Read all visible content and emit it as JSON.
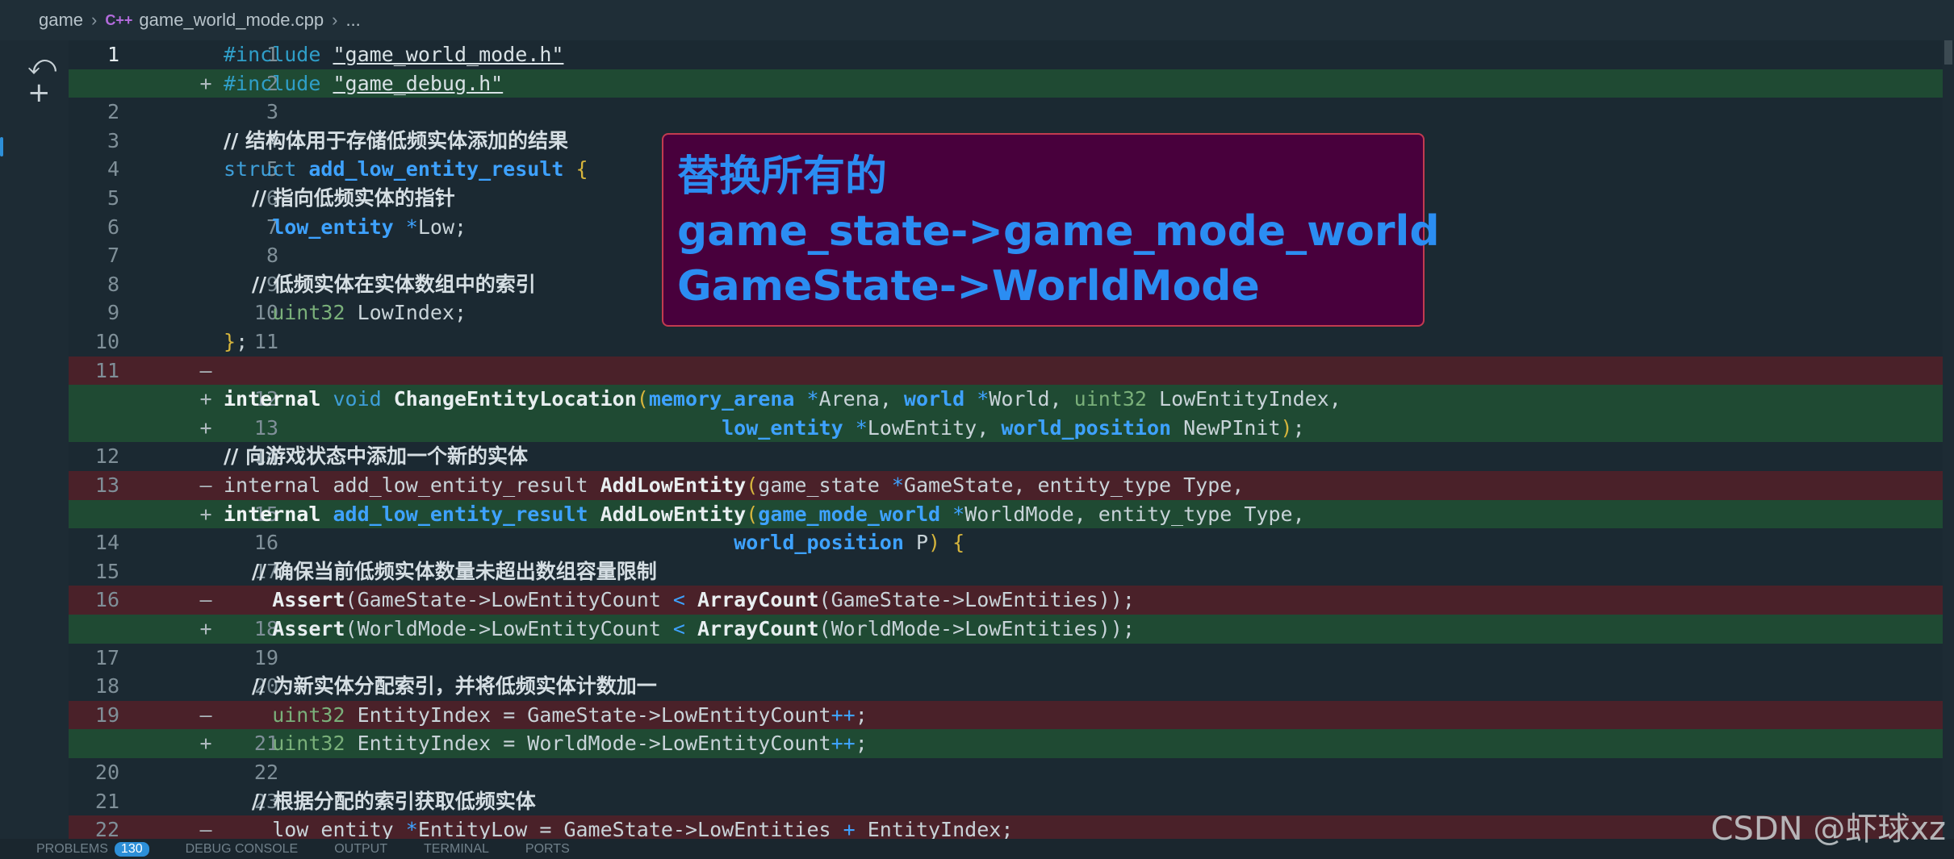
{
  "breadcrumb": {
    "root": "game",
    "file": "game_world_mode.cpp",
    "tail": "..."
  },
  "overlay": {
    "line1": "替换所有的",
    "line2": "game_state->game_mode_world",
    "line3": "GameState->WorldMode"
  },
  "bottom": {
    "problems": "PROBLEMS",
    "problems_count": "130",
    "debug_console": "DEBUG CONSOLE",
    "output": "OUTPUT",
    "terminal": "TERMINAL",
    "ports": "PORTS"
  },
  "watermark": "CSDN @虾球xz",
  "icons": {
    "undo": "undo-arrow-icon",
    "add": "plus-icon"
  },
  "colors": {
    "added": "#1f4a33",
    "removed": "#4a2129",
    "overlay_bg": "#48003c",
    "overlay_text": "#2b8df2"
  },
  "lines": [
    {
      "old": "1",
      "new": "1",
      "m": "",
      "t": "",
      "cls": "cur",
      "parts": [
        [
          "#include ",
          "k-macro"
        ],
        [
          "\"game_world_mode.h\"",
          "k-str"
        ]
      ]
    },
    {
      "old": "",
      "new": "2",
      "m": "+",
      "t": "add",
      "cls": "",
      "parts": [
        [
          "#include ",
          "k-macro"
        ],
        [
          "\"game_debug.h\"",
          "k-str"
        ]
      ]
    },
    {
      "old": "2",
      "new": "3",
      "m": "",
      "t": "",
      "cls": "",
      "parts": []
    },
    {
      "old": "3",
      "new": "4",
      "m": "",
      "t": "",
      "cls": "",
      "parts": [
        [
          "// 结构体用于存储低频实体添加的结果",
          "k-comment"
        ]
      ]
    },
    {
      "old": "4",
      "new": "5",
      "m": "",
      "t": "",
      "cls": "",
      "parts": [
        [
          "struct ",
          "k-kw"
        ],
        [
          "add_low_entity_result ",
          "k-type"
        ],
        [
          "{",
          "k-brace"
        ]
      ]
    },
    {
      "old": "5",
      "new": "6",
      "m": "",
      "t": "",
      "cls": "",
      "parts": [
        [
          "    // 指向低频实体的指针",
          "k-comment"
        ]
      ]
    },
    {
      "old": "6",
      "new": "7",
      "m": "",
      "t": "",
      "cls": "",
      "parts": [
        [
          "    low_entity ",
          "k-type"
        ],
        [
          "*",
          "k-ptr"
        ],
        [
          "Low;",
          ""
        ]
      ]
    },
    {
      "old": "7",
      "new": "8",
      "m": "",
      "t": "",
      "cls": "",
      "parts": []
    },
    {
      "old": "8",
      "new": "9",
      "m": "",
      "t": "",
      "cls": "",
      "parts": [
        [
          "    // 低频实体在实体数组中的索引",
          "k-comment"
        ]
      ]
    },
    {
      "old": "9",
      "new": "10",
      "m": "",
      "t": "",
      "cls": "",
      "parts": [
        [
          "    uint32 ",
          "k-dim"
        ],
        [
          "LowIndex;",
          ""
        ]
      ]
    },
    {
      "old": "10",
      "new": "11",
      "m": "",
      "t": "",
      "cls": "",
      "parts": [
        [
          "}",
          "k-brace"
        ],
        [
          ";",
          ""
        ]
      ]
    },
    {
      "old": "11",
      "new": "",
      "m": "—",
      "t": "del",
      "cls": "",
      "parts": []
    },
    {
      "old": "",
      "new": "12",
      "m": "+",
      "t": "add",
      "cls": "",
      "parts": [
        [
          "internal ",
          "k-bold"
        ],
        [
          "void ",
          "k-kw"
        ],
        [
          "ChangeEntityLocation",
          "k-func"
        ],
        [
          "(",
          "k-brace"
        ],
        [
          "memory_arena ",
          "k-type"
        ],
        [
          "*",
          "k-ptr"
        ],
        [
          "Arena, ",
          ""
        ],
        [
          "world ",
          "k-type"
        ],
        [
          "*",
          "k-ptr"
        ],
        [
          "World, ",
          ""
        ],
        [
          "uint32 ",
          "k-dim"
        ],
        [
          "LowEntityIndex,",
          ""
        ]
      ]
    },
    {
      "old": "",
      "new": "13",
      "m": "+",
      "t": "add",
      "cls": "",
      "parts": [
        [
          "                                         ",
          ""
        ],
        [
          "low_entity ",
          "k-type"
        ],
        [
          "*",
          "k-ptr"
        ],
        [
          "LowEntity, ",
          ""
        ],
        [
          "world_position ",
          "k-type"
        ],
        [
          "NewPInit",
          ""
        ],
        [
          ")",
          "k-brace"
        ],
        [
          ";",
          ""
        ]
      ]
    },
    {
      "old": "12",
      "new": "14",
      "m": "",
      "t": "",
      "cls": "",
      "parts": [
        [
          "// 向游戏状态中添加一个新的实体",
          "k-comment"
        ]
      ]
    },
    {
      "old": "13",
      "new": "",
      "m": "—",
      "t": "del",
      "cls": "",
      "parts": [
        [
          "internal add_low_entity_result ",
          ""
        ],
        [
          "AddLowEntity",
          "k-func"
        ],
        [
          "(",
          "k-brace"
        ],
        [
          "game_state ",
          ""
        ],
        [
          "*",
          "k-ptr"
        ],
        [
          "GameState, entity_type Type,",
          ""
        ]
      ]
    },
    {
      "old": "",
      "new": "15",
      "m": "+",
      "t": "add",
      "cls": "",
      "parts": [
        [
          "internal ",
          "k-bold"
        ],
        [
          "add_low_entity_result ",
          "k-type"
        ],
        [
          "AddLowEntity",
          "k-func"
        ],
        [
          "(",
          "k-brace"
        ],
        [
          "game_mode_world ",
          "k-type"
        ],
        [
          "*",
          "k-ptr"
        ],
        [
          "WorldMode, entity_type Type,",
          ""
        ]
      ]
    },
    {
      "old": "14",
      "new": "16",
      "m": "",
      "t": "",
      "cls": "",
      "parts": [
        [
          "                                          ",
          ""
        ],
        [
          "world_position ",
          "k-type"
        ],
        [
          "P",
          ""
        ],
        [
          ") {",
          "k-brace"
        ]
      ]
    },
    {
      "old": "15",
      "new": "17",
      "m": "",
      "t": "",
      "cls": "",
      "parts": [
        [
          "    // 确保当前低频实体数量未超出数组容量限制",
          "k-comment"
        ]
      ]
    },
    {
      "old": "16",
      "new": "",
      "m": "—",
      "t": "del",
      "cls": "",
      "parts": [
        [
          "    ",
          ""
        ],
        [
          "Assert",
          "k-func"
        ],
        [
          "(GameState->LowEntityCount ",
          ""
        ],
        [
          "< ",
          "k-lt"
        ],
        [
          "ArrayCount",
          "k-func"
        ],
        [
          "(GameState->LowEntities));",
          ""
        ]
      ]
    },
    {
      "old": "",
      "new": "18",
      "m": "+",
      "t": "add",
      "cls": "",
      "parts": [
        [
          "    ",
          ""
        ],
        [
          "Assert",
          "k-func"
        ],
        [
          "(WorldMode->LowEntityCount ",
          ""
        ],
        [
          "< ",
          "k-lt"
        ],
        [
          "ArrayCount",
          "k-func"
        ],
        [
          "(WorldMode->LowEntities));",
          ""
        ]
      ]
    },
    {
      "old": "17",
      "new": "19",
      "m": "",
      "t": "",
      "cls": "",
      "parts": []
    },
    {
      "old": "18",
      "new": "20",
      "m": "",
      "t": "",
      "cls": "",
      "parts": [
        [
          "    // 为新实体分配索引，并将低频实体计数加一",
          "k-comment"
        ]
      ]
    },
    {
      "old": "19",
      "new": "",
      "m": "—",
      "t": "del",
      "cls": "",
      "parts": [
        [
          "    uint32 ",
          "k-dim"
        ],
        [
          "EntityIndex = GameState->LowEntityCount",
          ""
        ],
        [
          "++",
          "k-lt"
        ],
        [
          ";",
          ""
        ]
      ]
    },
    {
      "old": "",
      "new": "21",
      "m": "+",
      "t": "add",
      "cls": "",
      "parts": [
        [
          "    uint32 ",
          "k-dim"
        ],
        [
          "EntityIndex = WorldMode->LowEntityCount",
          ""
        ],
        [
          "++",
          "k-lt"
        ],
        [
          ";",
          ""
        ]
      ]
    },
    {
      "old": "20",
      "new": "22",
      "m": "",
      "t": "",
      "cls": "",
      "parts": []
    },
    {
      "old": "21",
      "new": "23",
      "m": "",
      "t": "",
      "cls": "",
      "parts": [
        [
          "    // 根据分配的索引获取低频实体",
          "k-comment"
        ]
      ]
    },
    {
      "old": "22",
      "new": "",
      "m": "—",
      "t": "del",
      "cls": "",
      "parts": [
        [
          "    low_entity ",
          ""
        ],
        [
          "*",
          "k-ptr"
        ],
        [
          "EntityLow = GameState->LowEntities ",
          ""
        ],
        [
          "+ ",
          "k-lt"
        ],
        [
          "EntityIndex;",
          ""
        ]
      ]
    }
  ]
}
